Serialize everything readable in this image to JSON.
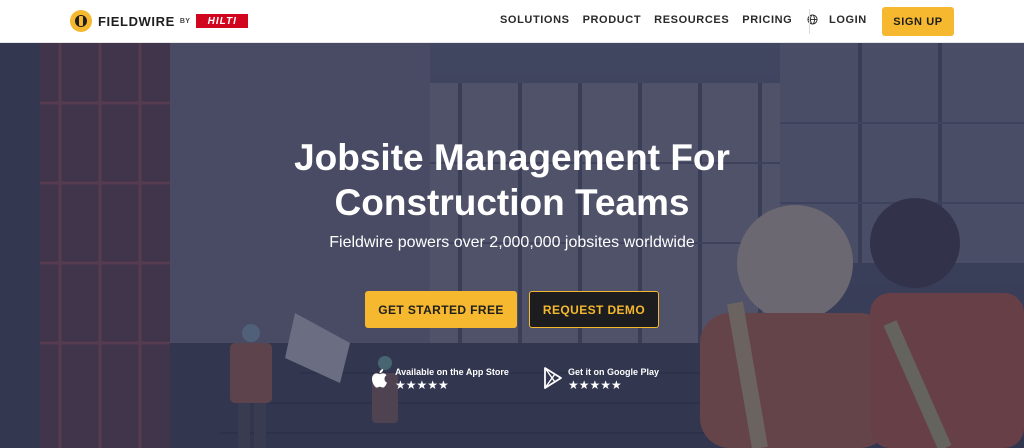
{
  "header": {
    "brand": "FIELDWIRE",
    "by": "BY",
    "partner": "HILTI",
    "nav": [
      {
        "label": "SOLUTIONS"
      },
      {
        "label": "PRODUCT"
      },
      {
        "label": "RESOURCES"
      },
      {
        "label": "PRICING"
      }
    ],
    "globe_icon": "globe-icon",
    "login_label": "LOGIN",
    "signup_label": "SIGN UP"
  },
  "hero": {
    "title_line1": "Jobsite Management For",
    "title_line2": "Construction Teams",
    "subtitle": "Fieldwire powers over 2,000,000 jobsites worldwide",
    "primary_cta": "GET STARTED FREE",
    "secondary_cta": "REQUEST DEMO",
    "app_store": {
      "label": "Available on the App Store",
      "rating": "★★★★★",
      "icon": "apple-icon"
    },
    "google_play": {
      "label": "Get it on Google Play",
      "rating": "★★★★★",
      "icon": "play-icon"
    }
  },
  "colors": {
    "accent": "#f5b82e",
    "hilti_red": "#d2051e",
    "overlay": "#2c3252",
    "dark": "#1e1e1e"
  }
}
